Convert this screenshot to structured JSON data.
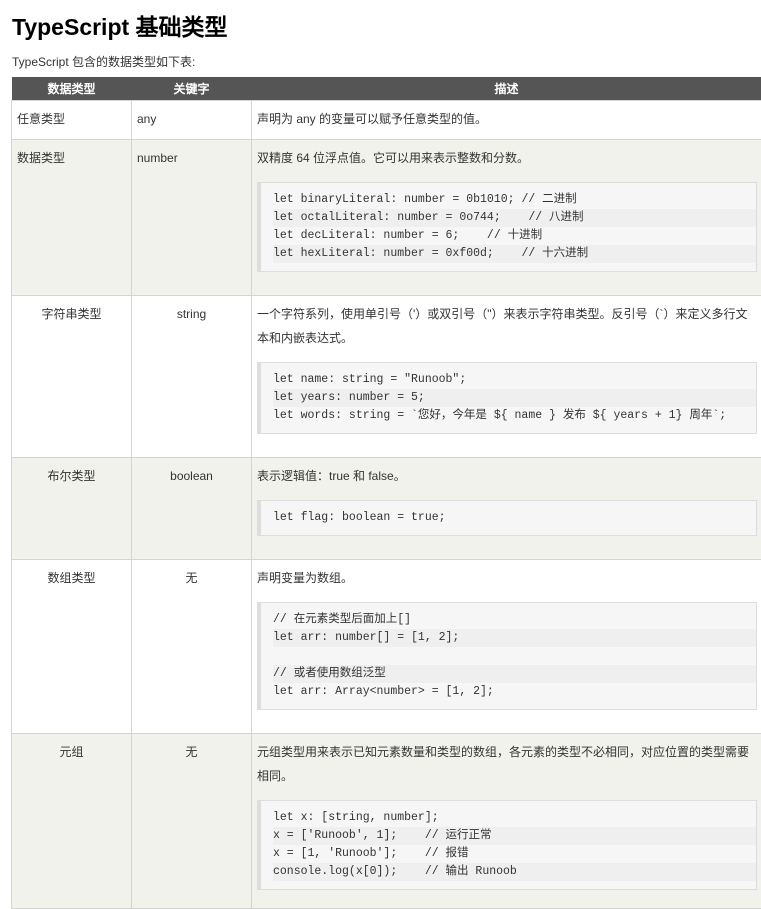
{
  "title": "TypeScript 基础类型",
  "intro": "TypeScript 包含的数据类型如下表:",
  "table": {
    "headers": [
      "数据类型",
      "关键字",
      "描述"
    ],
    "rows": [
      {
        "type": "任意类型",
        "keyword": "any",
        "desc": "声明为 any 的变量可以赋予任意类型的值。",
        "code": []
      },
      {
        "type": "数据类型",
        "keyword": "number",
        "desc": "双精度 64 位浮点值。它可以用来表示整数和分数。",
        "code": [
          "let binaryLiteral: number = 0b1010; // 二进制",
          "let octalLiteral: number = 0o744;    // 八进制",
          "let decLiteral: number = 6;    // 十进制",
          "let hexLiteral: number = 0xf00d;    // 十六进制"
        ]
      },
      {
        "type": "字符串类型",
        "keyword": "string",
        "desc": "一个字符系列，使用单引号（'）或双引号（\"）来表示字符串类型。反引号（`）来定义多行文本和内嵌表达式。",
        "code": [
          "let name: string = \"Runoob\";",
          "let years: number = 5;",
          "let words: string = `您好，今年是 ${ name } 发布 ${ years + 1} 周年`;"
        ]
      },
      {
        "type": "布尔类型",
        "keyword": "boolean",
        "desc": "表示逻辑值：true 和 false。",
        "code": [
          "let flag: boolean = true;"
        ]
      },
      {
        "type": "数组类型",
        "keyword": "无",
        "desc": "声明变量为数组。",
        "code": [
          "// 在元素类型后面加上[]",
          "let arr: number[] = [1, 2];",
          "",
          "// 或者使用数组泛型",
          "let arr: Array<number> = [1, 2];"
        ]
      },
      {
        "type": "元组",
        "keyword": "无",
        "desc": "元组类型用来表示已知元素数量和类型的数组，各元素的类型不必相同，对应位置的类型需要相同。",
        "code": [
          "let x: [string, number];",
          "x = ['Runoob', 1];    // 运行正常",
          "x = [1, 'Runoob'];    // 报错",
          "console.log(x[0]);    // 输出 Runoob"
        ]
      }
    ]
  }
}
